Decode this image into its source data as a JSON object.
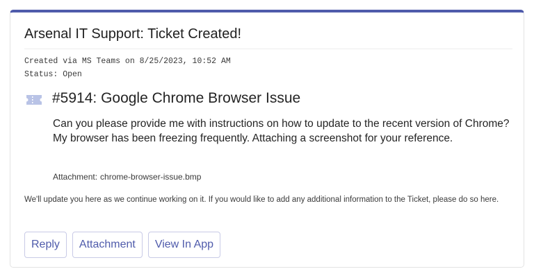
{
  "card": {
    "title": "Arsenal IT Support: Ticket Created!",
    "created_line": "Created via MS Teams on 8/25/2023, 10:52 AM",
    "status_line": "Status: Open",
    "accent_color": "#4f5bab"
  },
  "ticket": {
    "icon": "ticket-icon",
    "title": "#5914: Google Chrome Browser Issue",
    "description": "Can you please provide me with instructions on how to update to the recent version of Chrome? My browser has been freezing frequently. Attaching a screenshot for your reference.",
    "attachment_label": "Attachment:",
    "attachment_name": "chrome-browser-issue.bmp"
  },
  "footer_note": "We'll update you here as we continue working on it. If you would like to add any additional information to the Ticket, please do so here.",
  "actions": {
    "reply_label": "Reply",
    "attachment_label": "Attachment",
    "view_in_app_label": "View In App"
  }
}
